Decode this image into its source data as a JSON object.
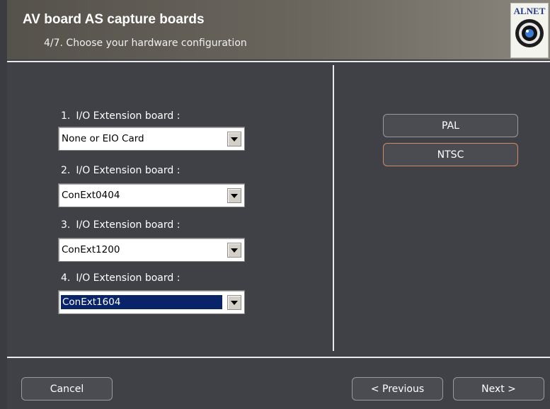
{
  "header": {
    "title": "AV board AS capture boards",
    "subtitle": "4/7. Choose your hardware configuration",
    "logo_text": "ALNET"
  },
  "boards": [
    {
      "number": "1.",
      "label": "I/O Extension board :",
      "value": "None or EIO Card"
    },
    {
      "number": "2.",
      "label": "I/O Extension board :",
      "value": "ConExt0404"
    },
    {
      "number": "3.",
      "label": "I/O Extension board :",
      "value": "ConExt1200"
    },
    {
      "number": "4.",
      "label": "I/O Extension board :",
      "value": "ConExt1604"
    }
  ],
  "video_standard": {
    "pal_label": "PAL",
    "ntsc_label": "NTSC",
    "selected": "NTSC"
  },
  "footer": {
    "cancel_label": "Cancel",
    "previous_label": "< Previous",
    "next_label": "Next >"
  },
  "colors": {
    "background": "#3f4147",
    "selected_highlight": "#0a246a",
    "active_button_border": "#d38a63"
  }
}
